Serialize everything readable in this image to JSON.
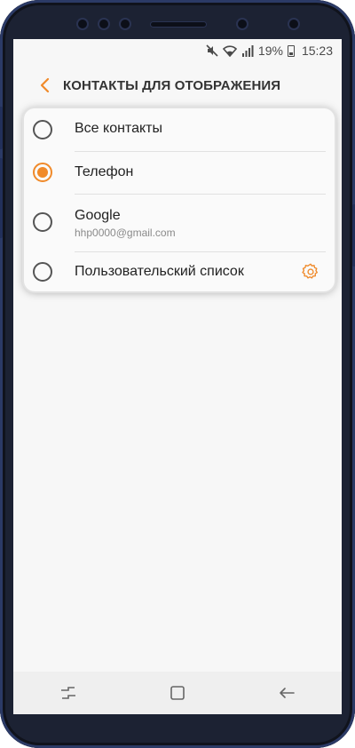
{
  "status_bar": {
    "battery_percent": "19%",
    "time": "15:23",
    "icons": [
      "mute-icon",
      "wifi-icon",
      "signal-icon",
      "battery-icon"
    ]
  },
  "app_bar": {
    "back_icon": "chevron-left-icon",
    "title": "КОНТАКТЫ ДЛЯ ОТОБРАЖЕНИЯ"
  },
  "options": [
    {
      "label": "Все контакты",
      "selected": false
    },
    {
      "label": "Телефон",
      "selected": true
    },
    {
      "label": "Google",
      "sublabel": "hhp0000@gmail.com",
      "selected": false
    },
    {
      "label": "Пользовательский список",
      "selected": false,
      "trailing_icon": "gear-icon"
    }
  ],
  "navigation_bar": {
    "buttons": [
      "recent-apps-icon",
      "home-icon",
      "back-arrow-icon"
    ]
  },
  "colors": {
    "accent": "#f08a2a",
    "screen_bg": "#f7f7f7",
    "phone_body": "#1c2233"
  }
}
